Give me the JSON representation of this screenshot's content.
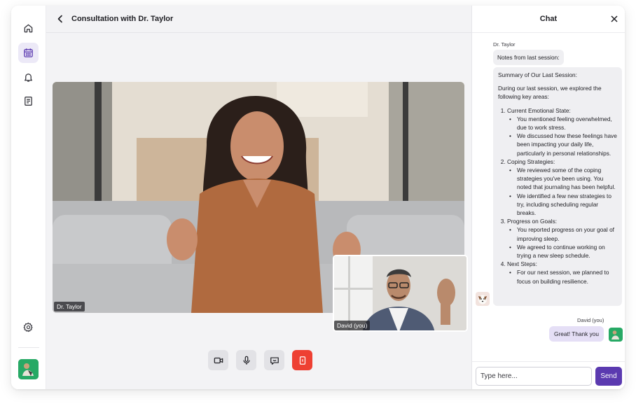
{
  "header": {
    "title": "Consultation with Dr. Taylor"
  },
  "sidebar": {
    "items": [
      {
        "icon": "home-icon"
      },
      {
        "icon": "calendar-icon",
        "active": true
      },
      {
        "icon": "bell-icon"
      },
      {
        "icon": "document-icon"
      }
    ],
    "settings_icon": "gear-icon"
  },
  "video": {
    "main_label": "Dr. Taylor",
    "pip_label": "David (you)"
  },
  "controls": [
    {
      "icon": "camera-icon"
    },
    {
      "icon": "microphone-icon"
    },
    {
      "icon": "chat-bubble-icon"
    },
    {
      "icon": "end-call-icon"
    }
  ],
  "chat": {
    "title": "Chat",
    "sender_doctor": "Dr. Taylor",
    "msg_notes": "Notes from last session:",
    "summary": {
      "heading": "Summary of Our Last Session:",
      "intro": "During our last session, we explored the following key areas:",
      "sections": [
        {
          "title": "Current Emotional State:",
          "bullets": [
            "You mentioned feeling overwhelmed, due to work stress.",
            "We discussed how these feelings have been impacting your daily life, particularly in personal relationships."
          ]
        },
        {
          "title": "Coping Strategies:",
          "bullets": [
            "We reviewed some of the coping strategies you've been using. You noted that journaling has been helpful.",
            "We identified a few new strategies to try, including scheduling regular breaks."
          ]
        },
        {
          "title": "Progress on Goals:",
          "bullets": [
            "You reported progress on your goal of improving sleep.",
            "We agreed to continue working on trying a new sleep schedule."
          ]
        },
        {
          "title": "Next Steps:",
          "bullets": [
            "For our next session, we planned to focus on building resilience."
          ]
        }
      ]
    },
    "sender_me": "David (you)",
    "msg_me": "Great! Thank you",
    "input_placeholder": "Type here...",
    "send_label": "Send"
  },
  "colors": {
    "accent": "#5b3ab0",
    "end_call": "#ee4033",
    "my_bubble": "#e5dff6"
  }
}
